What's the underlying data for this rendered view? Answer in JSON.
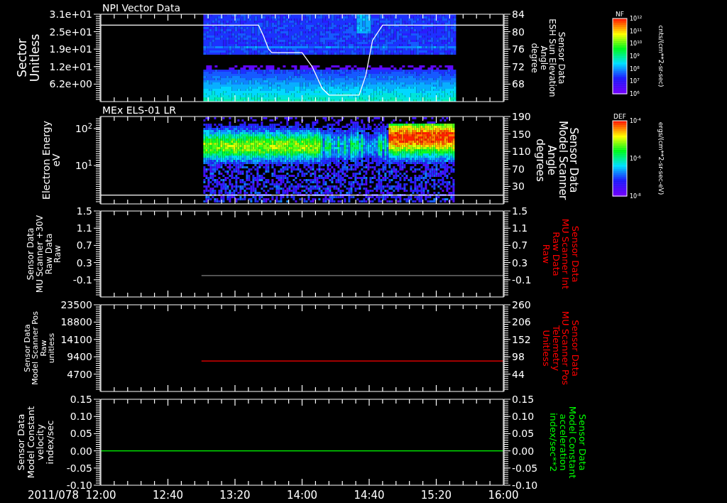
{
  "date": "2011/078",
  "panels": [
    {
      "kind": "spectrogram",
      "title": "NPI Vector Data",
      "right_axis_data": true,
      "left_axis": {
        "title": [
          "Sector",
          "Unitless"
        ],
        "tick_labels": [
          "3.1e+01",
          "2.5e+01",
          "1.9e+01",
          "1.2e+01",
          "6.2e+00"
        ]
      },
      "right_axis": {
        "title": [
          "Sensor Data",
          "ESH Sun Elevation",
          "Angle",
          "degree"
        ],
        "color": "#ffffff"
      },
      "chart_data": {
        "type": "line",
        "xlim": [
          12,
          16
        ],
        "ylim": [
          64,
          84
        ],
        "yticks": [
          {
            "value": 84,
            "label": "84"
          },
          {
            "value": 80,
            "label": "80"
          },
          {
            "value": 76,
            "label": "76"
          },
          {
            "value": 72,
            "label": "72"
          },
          {
            "value": 68,
            "label": "68"
          }
        ],
        "x": [
          12,
          13.567,
          13.617,
          13.667,
          13.7,
          14,
          14.1,
          14.2,
          14.267,
          14.567,
          14.633,
          14.7,
          14.8,
          16
        ],
        "series": [
          {
            "color": "#ffffff",
            "values": [
              81.5,
              81.5,
              79,
              76,
              75.2,
              75.2,
              72,
              67,
              65.5,
              65.5,
              70,
              78,
              81.5,
              81.5
            ]
          }
        ]
      }
    },
    {
      "kind": "spectrogram",
      "title": "MEx ELS-01 LR",
      "right_axis_data": true,
      "left_axis": {
        "title": [
          "Electron Energy",
          "eV"
        ],
        "tick_labels": [
          "10$^{2}$",
          "10$^{1}$"
        ]
      },
      "right_axis": {
        "title": [
          "Sensor Data",
          "Model Scanner",
          "Angle",
          "degrees"
        ],
        "color": "#ffffff"
      },
      "chart_data": {
        "type": "line",
        "xlim": [
          12,
          16
        ],
        "ylim": [
          -10,
          190
        ],
        "yticks": [
          {
            "value": 190,
            "label": "190"
          },
          {
            "value": 150,
            "label": "150"
          },
          {
            "value": 110,
            "label": "110"
          },
          {
            "value": 70,
            "label": "70"
          },
          {
            "value": 30,
            "label": "30"
          }
        ],
        "x": [
          12,
          16
        ],
        "series": [
          {
            "color": "#ffffff",
            "values": [
              10,
              10
            ]
          }
        ]
      }
    },
    {
      "kind": "line",
      "right_axis_data": false,
      "left_axis": {
        "title": [
          "Sensor Data",
          "MU Scanner +30V",
          "Raw Data",
          "Raw"
        ]
      },
      "right_axis": {
        "title": [
          "Sensor Data",
          "MU Scanner Int",
          "Raw Data",
          "Raw"
        ],
        "color": "#ff0000",
        "tick_labels": [
          "1.5",
          "1.1",
          "0.7",
          "0.3",
          "-0.1"
        ]
      },
      "chart_data": {
        "type": "line",
        "xlim": [
          12,
          16
        ],
        "ylim": [
          -0.5,
          1.5
        ],
        "yticks": [
          {
            "value": 1.5,
            "label": "1.5"
          },
          {
            "value": 1.1,
            "label": "1.1"
          },
          {
            "value": 0.7,
            "label": "0.7"
          },
          {
            "value": 0.3,
            "label": "0.3"
          },
          {
            "value": -0.1,
            "label": "-0.1"
          }
        ],
        "x": [
          13,
          16
        ],
        "series": [
          {
            "color": "#808080",
            "values": [
              0,
              0
            ]
          }
        ]
      }
    },
    {
      "kind": "line",
      "right_axis_data": true,
      "left_axis": {
        "title": [
          "Sensor Data",
          "Model Scanner Pos",
          "Raw",
          "unitless"
        ],
        "tick_labels": [
          "23500",
          "18800",
          "14100",
          "9400",
          "4700"
        ]
      },
      "right_axis": {
        "title": [
          "Sensor Data",
          "MU Scanner Pos",
          "Telemetry",
          "Unitless"
        ],
        "color": "#ff0000"
      },
      "chart_data": {
        "type": "line",
        "xlim": [
          12,
          16
        ],
        "ylim": [
          -10,
          260
        ],
        "yticks": [
          {
            "value": 260,
            "label": "260"
          },
          {
            "value": 206,
            "label": "206"
          },
          {
            "value": 152,
            "label": "152"
          },
          {
            "value": 98,
            "label": "98"
          },
          {
            "value": 44,
            "label": "44"
          }
        ],
        "x": [
          13,
          16
        ],
        "series": [
          {
            "color": "#ff0000",
            "values": [
              85,
              85
            ]
          }
        ]
      }
    },
    {
      "kind": "line",
      "right_axis_data": false,
      "left_axis": {
        "title": [
          "Sensor Data",
          "Model Constant",
          "velocity",
          "index/sec"
        ]
      },
      "right_axis": {
        "title": [
          "Sensor Data",
          "Model Constant",
          "acceleration",
          "index/sec**2"
        ],
        "color": "#00ff00",
        "tick_labels": [
          "0.15",
          "0.10",
          "0.05",
          "0.00",
          "-0.05",
          "-0.10"
        ]
      },
      "chart_data": {
        "type": "line",
        "xlim": [
          12,
          16
        ],
        "ylim": [
          -0.1,
          0.15
        ],
        "yticks": [
          {
            "value": 0.15,
            "label": "0.15"
          },
          {
            "value": 0.1,
            "label": "0.10"
          },
          {
            "value": 0.05,
            "label": "0.05"
          },
          {
            "value": 0,
            "label": "0.00"
          },
          {
            "value": -0.05,
            "label": "-0.05"
          },
          {
            "value": -0.1,
            "label": "-0.10"
          }
        ],
        "xticks": [
          {
            "value": 12,
            "label": "12:00"
          },
          {
            "value": 12.667,
            "label": "12:40"
          },
          {
            "value": 13.333,
            "label": "13:20"
          },
          {
            "value": 14,
            "label": "14:00"
          },
          {
            "value": 14.667,
            "label": "14:40"
          },
          {
            "value": 15.333,
            "label": "15:20"
          },
          {
            "value": 16,
            "label": "16:00"
          }
        ],
        "x": [
          12,
          16
        ],
        "series": [
          {
            "color": "#00ff00",
            "values": [
              0,
              0
            ]
          }
        ]
      }
    }
  ],
  "color_scales": [
    {
      "title": "NF",
      "units": "cnts/(cm**2-sr-sec)",
      "labels": [
        "10$^{12}$",
        "10$^{11}$",
        "10$^{10}$",
        "10$^{9}$",
        "10$^{8}$",
        "10$^{7}$",
        "10$^{6}$"
      ]
    },
    {
      "title": "DEF",
      "units": "ergs/(cm**2-sr-sec-eV)",
      "labels": [
        "10$^{-4}$",
        "10$^{-6}$",
        "10$^{-8}$"
      ]
    }
  ]
}
